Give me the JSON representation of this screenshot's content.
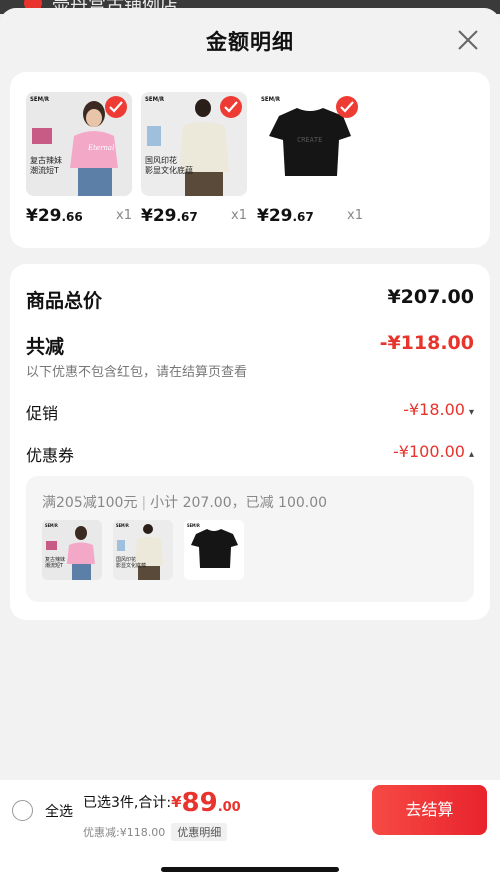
{
  "background_peek": "壶丹宫古铺例店",
  "header": {
    "title": "金额明细"
  },
  "products": [
    {
      "brand": "SEM/R",
      "tag": "复古辣妹\n潮流短T",
      "price_main": "¥29",
      "price_dec": ".66",
      "qty": "x1",
      "color": "#f4a8c8"
    },
    {
      "brand": "SEM/R",
      "tag": "国风印花\n影显文化底蕴",
      "price_main": "¥29",
      "price_dec": ".67",
      "qty": "x1",
      "color": "#e8e4d4"
    },
    {
      "brand": "SEM/R",
      "tag": "",
      "price_main": "¥29",
      "price_dec": ".67",
      "qty": "x1",
      "color": "#1a1a1a"
    }
  ],
  "summary": {
    "total_label": "商品总价",
    "total_value": "¥207.00",
    "reduce_label": "共减",
    "reduce_value": "-¥118.00",
    "reduce_note": "以下优惠不包含红包，请在结算页查看",
    "promo_label": "促销",
    "promo_value": "-¥18.00",
    "coupon_label": "优惠券",
    "coupon_value": "-¥100.00",
    "coupon_rule": "满205减100元",
    "coupon_detail": "小计 207.00，已减 100.00"
  },
  "footer": {
    "select_all": "全选",
    "selected_text": "已选3件,合计:",
    "currency": "¥",
    "amount": "89",
    "amount_dec": ".00",
    "discount_text": "优惠减:¥118.00",
    "detail_button": "优惠明细",
    "checkout_button": "去结算"
  },
  "colors": {
    "accent": "#e8342c",
    "checkout_gradient_start": "#f74a44",
    "checkout_gradient_end": "#e8232d"
  }
}
